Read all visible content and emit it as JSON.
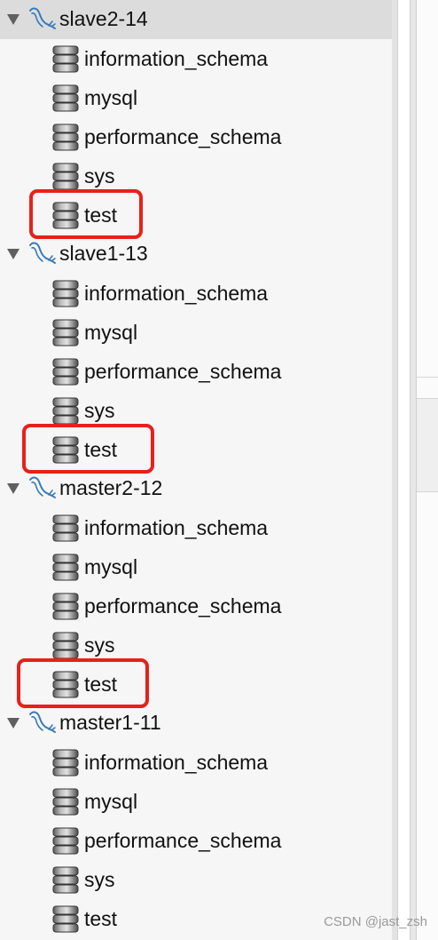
{
  "tree": {
    "connections": [
      {
        "name": "slave2-14",
        "icon": "mysql-dolphin-icon",
        "expanded": true,
        "selected": true,
        "databases": [
          {
            "name": "information_schema",
            "icon": "database-icon"
          },
          {
            "name": "mysql",
            "icon": "database-icon"
          },
          {
            "name": "performance_schema",
            "icon": "database-icon"
          },
          {
            "name": "sys",
            "icon": "database-icon"
          },
          {
            "name": "test",
            "icon": "database-icon",
            "highlighted": true
          }
        ]
      },
      {
        "name": "slave1-13",
        "icon": "mysql-dolphin-icon",
        "expanded": true,
        "databases": [
          {
            "name": "information_schema",
            "icon": "database-icon"
          },
          {
            "name": "mysql",
            "icon": "database-icon"
          },
          {
            "name": "performance_schema",
            "icon": "database-icon"
          },
          {
            "name": "sys",
            "icon": "database-icon"
          },
          {
            "name": "test",
            "icon": "database-icon",
            "highlighted": true
          }
        ]
      },
      {
        "name": "master2-12",
        "icon": "mysql-dolphin-icon",
        "expanded": true,
        "databases": [
          {
            "name": "information_schema",
            "icon": "database-icon"
          },
          {
            "name": "mysql",
            "icon": "database-icon"
          },
          {
            "name": "performance_schema",
            "icon": "database-icon"
          },
          {
            "name": "sys",
            "icon": "database-icon"
          },
          {
            "name": "test",
            "icon": "database-icon",
            "highlighted": true
          }
        ]
      },
      {
        "name": "master1-11",
        "icon": "mysql-dolphin-icon",
        "expanded": true,
        "databases": [
          {
            "name": "information_schema",
            "icon": "database-icon"
          },
          {
            "name": "mysql",
            "icon": "database-icon"
          },
          {
            "name": "performance_schema",
            "icon": "database-icon"
          },
          {
            "name": "sys",
            "icon": "database-icon"
          },
          {
            "name": "test",
            "icon": "database-icon"
          }
        ]
      }
    ]
  },
  "watermark": "CSDN @jast_zsh",
  "colors": {
    "highlight_border": "#e8201a",
    "selected_row": "#dcdcdc",
    "sidebar_bg": "#f6f6f6",
    "dolphin": "#3b7ab8"
  }
}
